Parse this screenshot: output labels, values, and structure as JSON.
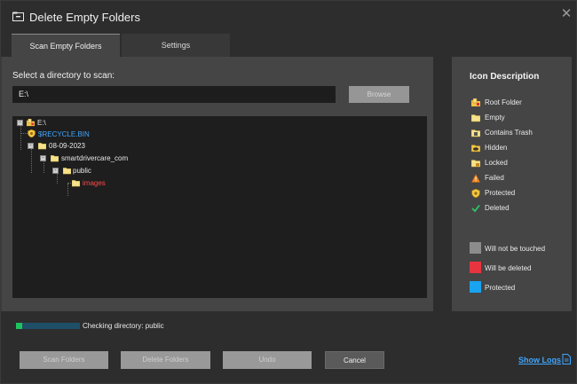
{
  "window": {
    "title": "Delete Empty Folders",
    "close_glyph": "✕"
  },
  "tabs": [
    {
      "label": "Scan Empty Folders",
      "active": true
    },
    {
      "label": "Settings",
      "active": false
    }
  ],
  "scan": {
    "directory_label": "Select a directory to scan:",
    "path_value": "E:\\",
    "browse_label": "Browse"
  },
  "tree": [
    {
      "label": "E:\\",
      "icon": "root-folder-icon",
      "color": "#e8e8e8",
      "toggle": "-"
    },
    {
      "label": "$RECYCLE.BIN",
      "icon": "protected-icon",
      "color": "#3fa6ff",
      "toggle": ""
    },
    {
      "label": "08-09-2023",
      "icon": "folder-icon",
      "color": "#e8e8e8",
      "toggle": "-"
    },
    {
      "label": "smartdrivercare_com",
      "icon": "folder-icon",
      "color": "#e8e8e8",
      "toggle": "-"
    },
    {
      "label": "public",
      "icon": "folder-icon",
      "color": "#e8e8e8",
      "toggle": "-"
    },
    {
      "label": "images",
      "icon": "empty-folder-icon",
      "color": "#ff4a4a",
      "toggle": ""
    }
  ],
  "icon_description": {
    "title": "Icon Description",
    "items": [
      {
        "label": "Root Folder",
        "icon": "root-folder-icon"
      },
      {
        "label": "Empty",
        "icon": "empty-folder-icon"
      },
      {
        "label": "Contains Trash",
        "icon": "trash-folder-icon"
      },
      {
        "label": "Hidden",
        "icon": "hidden-folder-icon"
      },
      {
        "label": "Locked",
        "icon": "locked-folder-icon"
      },
      {
        "label": "Failed",
        "icon": "warning-icon"
      },
      {
        "label": "Protected",
        "icon": "protected-icon"
      },
      {
        "label": "Deleted",
        "icon": "check-icon"
      }
    ],
    "legend": [
      {
        "label": "Will not be touched",
        "color": "#8c8c8c"
      },
      {
        "label": "Will be deleted",
        "color": "#e8343e"
      },
      {
        "label": "Protected",
        "color": "#1aa3ef"
      }
    ]
  },
  "status": {
    "text": "Checking directory: public",
    "progress": 0.1
  },
  "buttons": {
    "scan": "Scan Folders",
    "delete": "Delete Folders",
    "undo": "Undo",
    "cancel": "Cancel"
  },
  "show_logs": "Show Logs",
  "colors": {
    "accent": "#3fa6ff",
    "deleted": "#ff4a4a",
    "progress_fill": "#1fc25e",
    "progress_track": "#1e4f66"
  }
}
